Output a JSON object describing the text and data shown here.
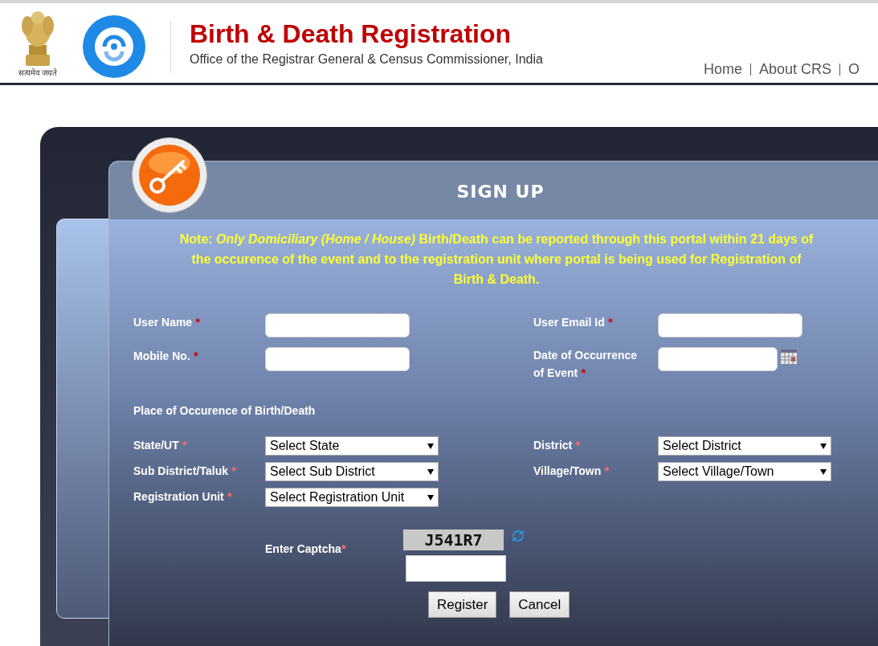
{
  "header": {
    "emblem_motto": "सत्यमेव जयते",
    "title": "Birth & Death Registration",
    "subtitle": "Office of the Registrar General & Census Commissioner, India",
    "nav": [
      {
        "label": "Home"
      },
      {
        "label": "About CRS"
      },
      {
        "label": "O"
      }
    ]
  },
  "form": {
    "title": "SIGN UP",
    "note": "Note: *Only Domiciliary (Home / House)* Birth/Death can be reported through this portal within 21 days of the occurence of the event and to the registration unit where portal is being used for Registration of Birth & Death.",
    "account_fields": [
      {
        "label": "User Name",
        "marker": "*",
        "kind": "text"
      },
      {
        "label": "User Email Id",
        "marker": "*",
        "kind": "text"
      },
      {
        "label": "Mobile No.",
        "marker": "*",
        "kind": "text"
      },
      {
        "label": "Date of Occurrence of Event",
        "marker": "*",
        "kind": "date"
      }
    ],
    "place_heading": "Place of Occurence of Birth/Death",
    "place_fields": [
      {
        "label": "State/UT",
        "marker": "*",
        "value": "Select State"
      },
      {
        "label": "District",
        "marker": "*",
        "value": "Select District"
      },
      {
        "label": "Sub District/Taluk",
        "marker": "*",
        "value": "Select Sub District"
      },
      {
        "label": "Village/Town",
        "marker": "*",
        "value": "Select Village/Town"
      },
      {
        "label": "Registration Unit",
        "marker": "*",
        "value": "Select Registration Unit"
      }
    ],
    "captcha": {
      "label": "Enter Captcha",
      "marker": "*",
      "code": "J541R7"
    },
    "buttons": [
      {
        "label": "Register"
      },
      {
        "label": "Cancel"
      }
    ]
  }
}
